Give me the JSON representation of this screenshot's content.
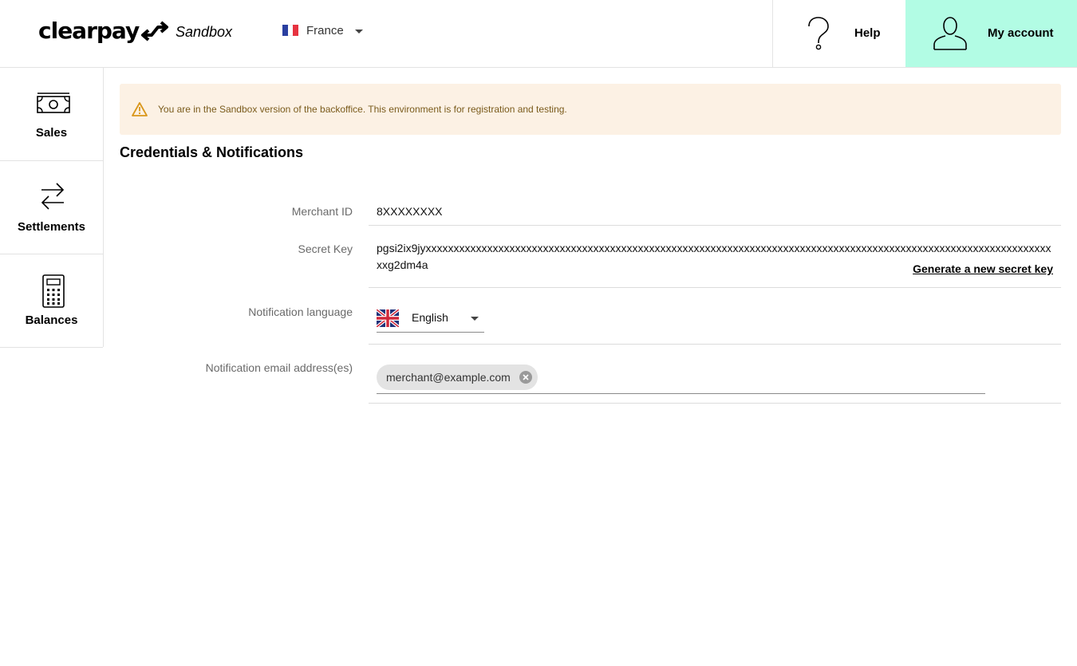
{
  "header": {
    "logo_text": "clearpay",
    "environment": "Sandbox",
    "country": "France",
    "help_label": "Help",
    "account_label": "My account",
    "account_bg": "#b2fce4"
  },
  "sidebar": {
    "items": [
      {
        "label": "Sales",
        "icon": "cash-icon"
      },
      {
        "label": "Settlements",
        "icon": "transfer-arrows-icon"
      },
      {
        "label": "Balances",
        "icon": "calculator-icon"
      }
    ]
  },
  "banner": {
    "text": "You are in the Sandbox version of the backoffice. This environment is for registration and testing.",
    "icon": "warning-icon",
    "bg": "#fcf1e4"
  },
  "page": {
    "title": "Credentials & Notifications"
  },
  "fields": {
    "merchant_id": {
      "label": "Merchant ID",
      "value": "8XXXXXXXX"
    },
    "secret_key": {
      "label": "Secret Key",
      "value": "pgsi2ix9jyxxxxxxxxxxxxxxxxxxxxxxxxxxxxxxxxxxxxxxxxxxxxxxxxxxxxxxxxxxxxxxxxxxxxxxxxxxxxxxxxxxxxxxxxxxxxxxxxxxxxxxxxxxxxxxxxxxg2dm4a",
      "action": "Generate a new secret key"
    },
    "notification_language": {
      "label": "Notification language",
      "value": "English"
    },
    "notification_emails": {
      "label": "Notification email address(es)",
      "emails": [
        "merchant@example.com"
      ]
    }
  }
}
